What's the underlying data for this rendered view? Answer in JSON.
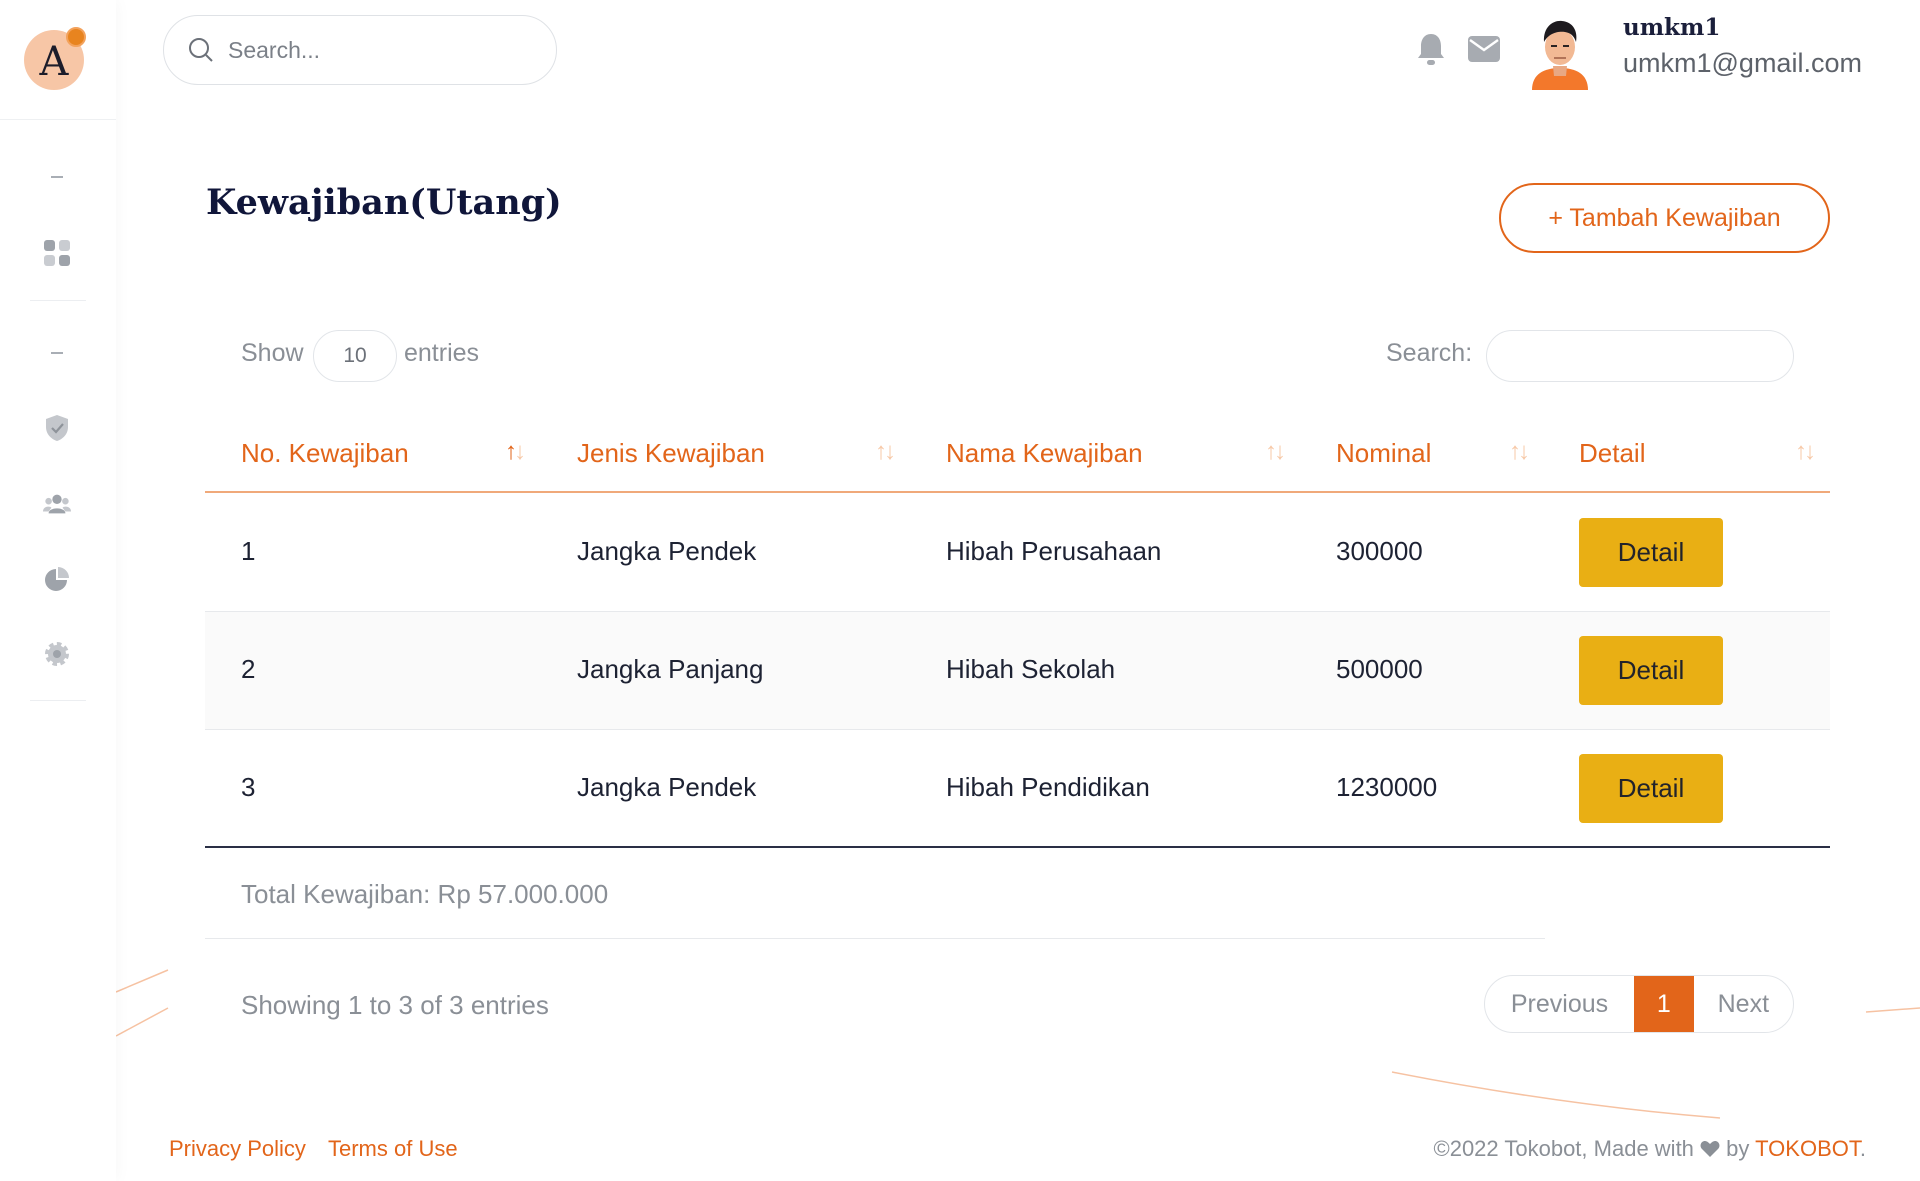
{
  "brand": {
    "logo_letter": "A"
  },
  "topbar": {
    "search_placeholder": "Search...",
    "user_name": "umkm1",
    "user_email": "umkm1@gmail.com"
  },
  "page": {
    "title": "Kewajiban(Utang)",
    "add_button": "+ Tambah Kewajiban"
  },
  "table_controls": {
    "show_label": "Show",
    "page_size": "10",
    "entries_label": "entries",
    "search_label": "Search:"
  },
  "table": {
    "columns": [
      "No. Kewajiban",
      "Jenis Kewajiban",
      "Nama Kewajiban",
      "Nominal",
      "Detail"
    ],
    "rows": [
      {
        "no": "1",
        "jenis": "Jangka Pendek",
        "nama": "Hibah Perusahaan",
        "nominal": "300000",
        "action": "Detail"
      },
      {
        "no": "2",
        "jenis": "Jangka Panjang",
        "nama": "Hibah Sekolah",
        "nominal": "500000",
        "action": "Detail"
      },
      {
        "no": "3",
        "jenis": "Jangka Pendek",
        "nama": "Hibah Pendidikan",
        "nominal": "1230000",
        "action": "Detail"
      }
    ],
    "total": "Total Kewajiban: Rp 57.000.000",
    "info": "Showing 1 to 3 of 3 entries"
  },
  "pagination": {
    "previous": "Previous",
    "current": "1",
    "next": "Next"
  },
  "footer": {
    "privacy": "Privacy Policy",
    "terms": "Terms of Use",
    "copyright_prefix": "©2022 Tokobot, Made with",
    "copyright_by": "by",
    "copyright_brand": "TOKOBOT",
    "copyright_suffix": "."
  },
  "colors": {
    "accent": "#e2651a",
    "detail_button": "#e9af14",
    "title": "#10163a"
  },
  "icons": {
    "sidebar": [
      "dashboard-icon",
      "shield-icon",
      "users-icon",
      "pie-chart-icon",
      "gear-icon"
    ],
    "topbar": [
      "search-icon",
      "bell-icon",
      "mail-icon"
    ]
  }
}
